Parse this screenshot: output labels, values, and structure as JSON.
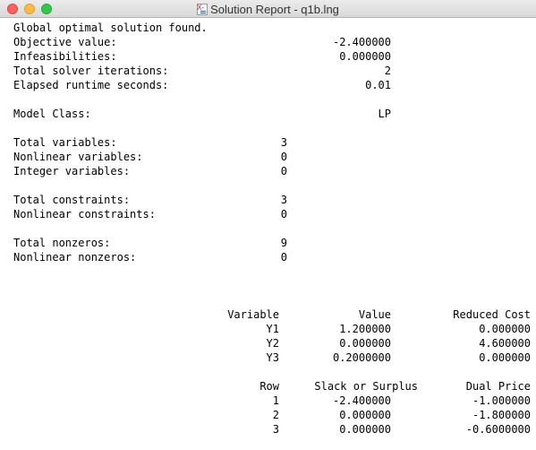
{
  "window": {
    "title": "Solution Report - q1b.lng",
    "icon": "lingo-document-icon"
  },
  "summary": {
    "status": "Global optimal solution found.",
    "rows": [
      {
        "label": "Objective value:",
        "value": "-2.400000"
      },
      {
        "label": "Infeasibilities:",
        "value": "0.000000"
      },
      {
        "label": "Total solver iterations:",
        "value": "2"
      },
      {
        "label": "Elapsed runtime seconds:",
        "value": "0.01"
      }
    ],
    "model_class": {
      "label": "Model Class:",
      "value": "LP"
    }
  },
  "counts": {
    "variables": [
      {
        "label": "Total variables:",
        "value": "3"
      },
      {
        "label": "Nonlinear variables:",
        "value": "0"
      },
      {
        "label": "Integer variables:",
        "value": "0"
      }
    ],
    "constraints": [
      {
        "label": "Total constraints:",
        "value": "3"
      },
      {
        "label": "Nonlinear constraints:",
        "value": "0"
      }
    ],
    "nonzeros": [
      {
        "label": "Total nonzeros:",
        "value": "9"
      },
      {
        "label": "Nonlinear nonzeros:",
        "value": "0"
      }
    ]
  },
  "variables_table": {
    "headers": [
      "Variable",
      "Value",
      "Reduced Cost"
    ],
    "rows": [
      [
        "Y1",
        "1.200000",
        "0.000000"
      ],
      [
        "Y2",
        "0.000000",
        "4.600000"
      ],
      [
        "Y3",
        "0.2000000",
        "0.000000"
      ]
    ]
  },
  "rows_table": {
    "headers": [
      "Row",
      "Slack or Surplus",
      "Dual Price"
    ],
    "rows": [
      [
        "1",
        "-2.400000",
        "-1.000000"
      ],
      [
        "2",
        "0.000000",
        "-1.800000"
      ],
      [
        "3",
        "0.000000",
        "-0.6000000"
      ]
    ]
  }
}
